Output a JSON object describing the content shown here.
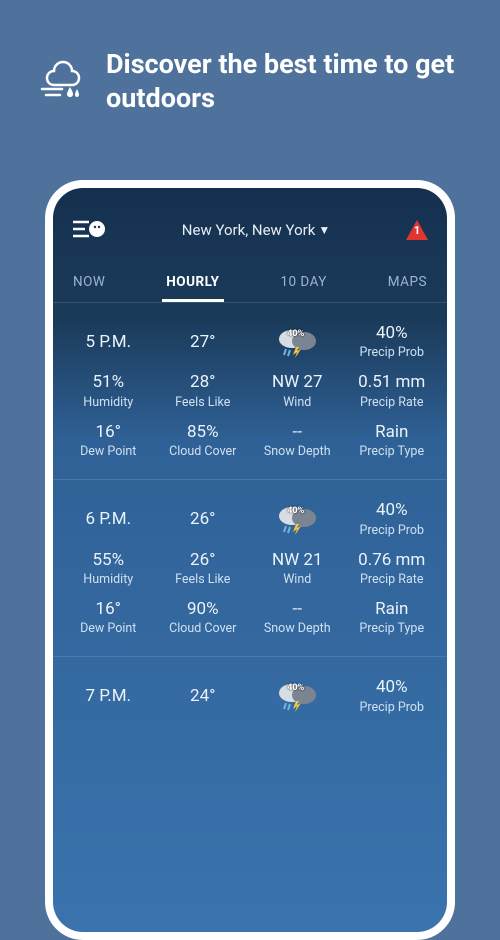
{
  "hero": {
    "title": "Discover the best time to get outdoors"
  },
  "location": "New York, New York",
  "alert_count": "1",
  "tabs": [
    "NOW",
    "HOURLY",
    "10 DAY",
    "MAPS"
  ],
  "active_tab": 1,
  "hours": [
    {
      "time": "5 P.M.",
      "temp": "27°",
      "icon_pct": "40%",
      "precip_prob": "40%",
      "humidity": "51%",
      "feels": "28°",
      "wind": "NW 27",
      "precip_rate": "0.51 mm",
      "dew": "16°",
      "cloud": "85%",
      "snow": "--",
      "ptype": "Rain"
    },
    {
      "time": "6 P.M.",
      "temp": "26°",
      "icon_pct": "40%",
      "precip_prob": "40%",
      "humidity": "55%",
      "feels": "26°",
      "wind": "NW 21",
      "precip_rate": "0.76 mm",
      "dew": "16°",
      "cloud": "90%",
      "snow": "--",
      "ptype": "Rain"
    },
    {
      "time": "7 P.M.",
      "temp": "24°",
      "icon_pct": "40%",
      "precip_prob": "40%",
      "humidity": "",
      "feels": "",
      "wind": "",
      "precip_rate": "",
      "dew": "",
      "cloud": "",
      "snow": "",
      "ptype": ""
    }
  ],
  "labels": {
    "precip_prob": "Precip Prob",
    "humidity": "Humidity",
    "feels": "Feels Like",
    "wind": "Wind",
    "precip_rate": "Precip Rate",
    "dew": "Dew Point",
    "cloud": "Cloud Cover",
    "snow": "Snow Depth",
    "ptype": "Precip Type"
  }
}
